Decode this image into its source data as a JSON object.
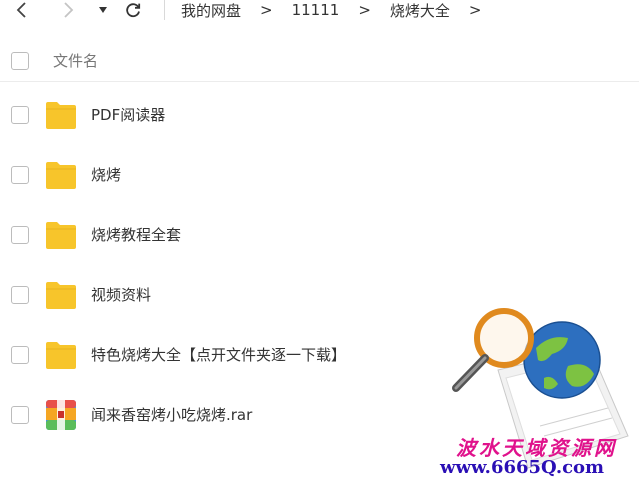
{
  "toolbar": {
    "back_icon": "chevron-left-icon",
    "forward_icon": "chevron-right-icon",
    "history_icon": "caret-down-icon",
    "refresh_icon": "refresh-icon"
  },
  "breadcrumb": {
    "items": [
      "我的网盘",
      "11111",
      "烧烤大全"
    ],
    "separator": ">"
  },
  "list": {
    "header_label": "文件名",
    "files": [
      {
        "name": "PDF阅读器",
        "type": "folder",
        "icon": "folder-icon"
      },
      {
        "name": "烧烤",
        "type": "folder",
        "icon": "folder-icon"
      },
      {
        "name": "烧烤教程全套",
        "type": "folder",
        "icon": "folder-icon"
      },
      {
        "name": "视频资料",
        "type": "folder",
        "icon": "folder-icon"
      },
      {
        "name": "特色烧烤大全【点开文件夹逐一下载】",
        "type": "folder",
        "icon": "folder-icon"
      },
      {
        "name": "闻来香窑烤小吃烧烤.rar",
        "type": "archive",
        "icon": "rar-archive-icon"
      }
    ]
  },
  "watermark": {
    "title": "波水天域资源网",
    "url": "www.6665Q.com",
    "icon": "magnifier-globe-icon"
  },
  "colors": {
    "folder": "#f7c52b",
    "watermark_title": "#e0128c",
    "watermark_url": "#2a0fb5"
  }
}
